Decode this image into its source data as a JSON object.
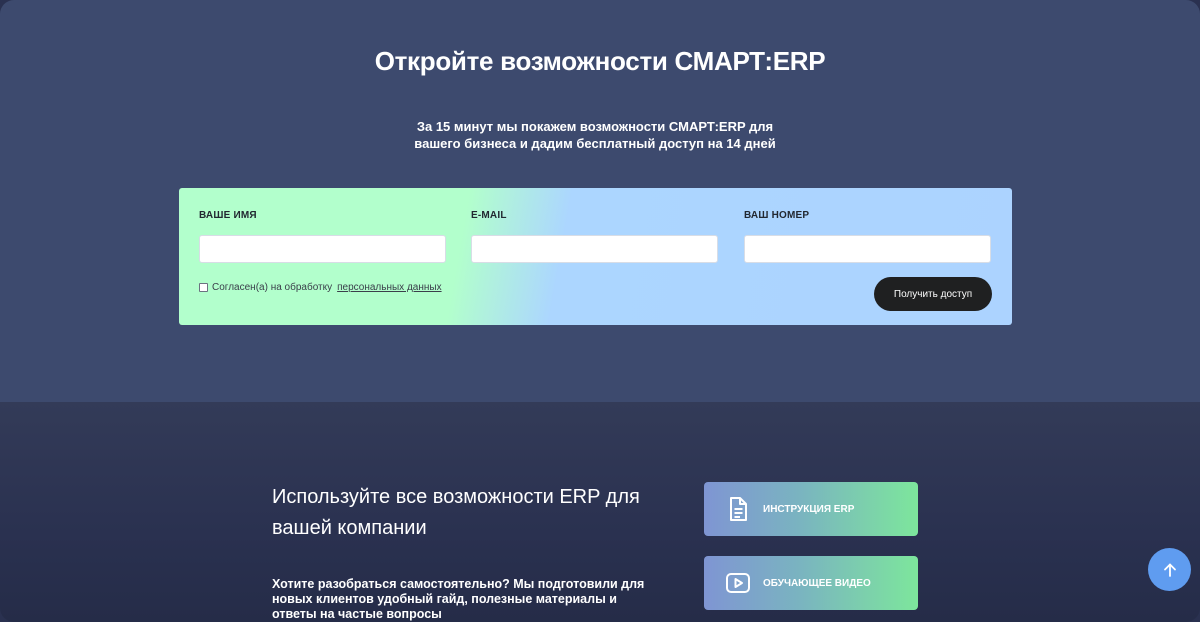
{
  "hero": {
    "title": "Откройте возможности СМАРТ:ERP",
    "subtitle_line1": "За 15 минут мы покажем возможности СМАРТ:ERP для",
    "subtitle_line2": "вашего бизнеса и дадим бесплатный доступ на 14 дней"
  },
  "form": {
    "name_label": "ВАШЕ ИМЯ",
    "name_value": "",
    "email_label": "E-MAIL",
    "email_value": "",
    "phone_label": "ВАШ НОМЕР",
    "phone_value": "",
    "consent_text": "Согласен(а) на обработку",
    "consent_link": "персональных данных",
    "submit_label": "Получить доступ"
  },
  "resources": {
    "title_line1": "Используйте все возможности ERP для",
    "title_line2": "вашей компании",
    "text_line1": "Хотите разобраться самостоятельно? Мы подготовили для",
    "text_line2": "новых клиентов удобный гайд, полезные материалы и",
    "text_line3": "ответы на частые вопросы",
    "guide_button": "ИНСТРУКЦИЯ ERP",
    "video_button": "ОБУЧАЮЩЕЕ ВИДЕО"
  },
  "icons": {
    "guide": "document-icon",
    "video": "play-icon",
    "scroll": "arrow-up-icon"
  },
  "colors": {
    "hero_bg": "#3d4a6e",
    "form_green": "#b2ffcc",
    "form_blue": "#acd3ff",
    "submit_bg": "#1f2021",
    "scroll_top_bg": "#5f9cf0"
  }
}
